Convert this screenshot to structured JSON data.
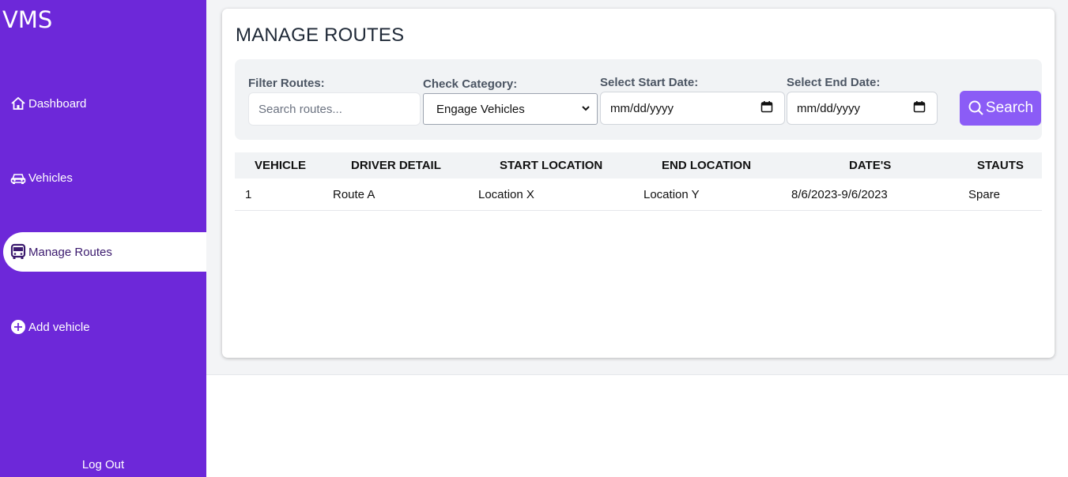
{
  "sidebar": {
    "brand": "VMS",
    "items": [
      {
        "label": "Dashboard",
        "icon": "home-icon"
      },
      {
        "label": "Vehicles",
        "icon": "car-icon"
      },
      {
        "label": "Manage Routes",
        "icon": "bus-icon",
        "active": true
      },
      {
        "label": "Add vehicle",
        "icon": "plus-circle-icon"
      }
    ],
    "logout_label": "Log Out"
  },
  "main": {
    "title": "MANAGE ROUTES",
    "filters": {
      "filter_label": "Filter Routes:",
      "filter_placeholder": "Search routes...",
      "category_label": "Check Category:",
      "category_value": "Engage Vehicles",
      "start_label": "Select Start Date:",
      "start_value": "mm/dd/yyyy",
      "end_label": "Select End Date:",
      "end_value": "mm/dd/yyyy",
      "search_label": "Search"
    },
    "table": {
      "headers": [
        "VEHICLE",
        "DRIVER DETAIL",
        "START LOCATION",
        "END LOCATION",
        "DATE'S",
        "STAUTS"
      ],
      "rows": [
        [
          "1",
          "Route A",
          "Location X",
          "Location Y",
          "8/6/2023-9/6/2023",
          "Spare"
        ]
      ]
    }
  },
  "colors": {
    "sidebar": "#6d28d9",
    "accent": "#8b5cf6"
  }
}
